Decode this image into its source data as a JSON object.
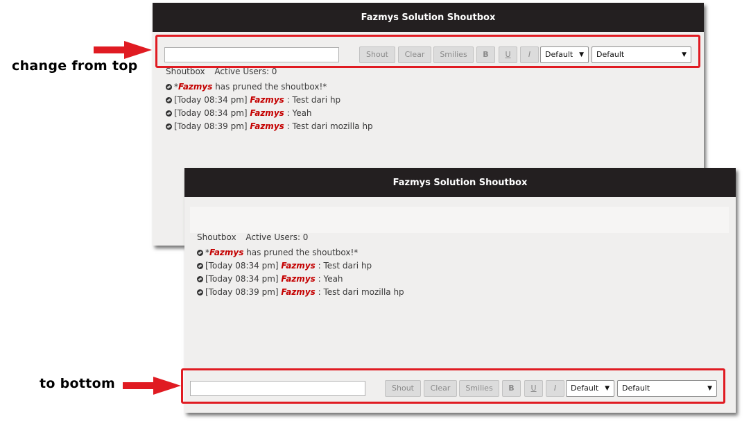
{
  "annotations": {
    "top_label": "change from top",
    "bottom_label": "to bottom",
    "highlight_color": "#e01b22"
  },
  "shoutbox": {
    "title": "Fazmys Solution Shoutbox",
    "status": {
      "tab": "Shoutbox",
      "active_users": "Active Users: 0"
    },
    "toolbar": {
      "input_value": "",
      "shout": "Shout",
      "clear": "Clear",
      "smilies": "Smilies",
      "bold": "B",
      "underline": "U",
      "italic": "I",
      "color_select": "Default",
      "font_select": "Default"
    },
    "messages": [
      {
        "prefix": "*",
        "user": "Fazmys",
        "text": " has pruned the shoutbox!*"
      },
      {
        "prefix": "[Today 08:34 pm] ",
        "user": "Fazmys",
        "text": " : Test dari hp"
      },
      {
        "prefix": "[Today 08:34 pm] ",
        "user": "Fazmys",
        "text": " : Yeah"
      },
      {
        "prefix": "[Today 08:39 pm] ",
        "user": "Fazmys",
        "text": " : Test dari mozilla hp"
      }
    ],
    "user_color": "#c40000",
    "titlebar_color": "#231f20"
  }
}
